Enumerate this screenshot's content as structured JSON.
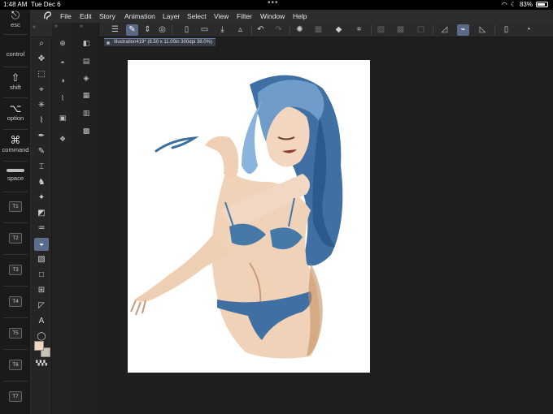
{
  "status_bar": {
    "time": "1:48 AM",
    "date": "Tue Dec 6",
    "battery": "83%",
    "battery_level": 0.83
  },
  "modifier_panel": {
    "keys": [
      {
        "glyph": "⎋",
        "label": "esc"
      },
      {
        "glyph": "",
        "label": "control"
      },
      {
        "glyph": "⇧",
        "label": "shift"
      },
      {
        "glyph": "⌥",
        "label": "option"
      },
      {
        "glyph": "⌘",
        "label": "command"
      },
      {
        "glyph": "",
        "label": "space"
      }
    ],
    "tool_keys": [
      "T1",
      "T2",
      "T3",
      "T4",
      "T5",
      "T6",
      "T7"
    ]
  },
  "menu": {
    "items": [
      "File",
      "Edit",
      "Story",
      "Animation",
      "Layer",
      "Select",
      "View",
      "Filter",
      "Window",
      "Help"
    ]
  },
  "document": {
    "tab_title": "Illustration419* (8.50 x 11.00in 300dpi 38.0%)"
  },
  "tools": {
    "icons": [
      "zoom-icon",
      "move-icon",
      "operation-icon",
      "selection-icon",
      "auto-select-icon",
      "eyedropper-icon",
      "pen-icon",
      "pencil-icon",
      "brush-icon",
      "airbrush-icon",
      "decoration-icon",
      "eraser-icon",
      "blend-icon",
      "fill-icon",
      "gradient-icon",
      "figure-icon",
      "frame-icon",
      "ruler-icon",
      "text-icon",
      "balloon-icon"
    ],
    "active_tool": "fill-icon"
  },
  "colors": {
    "main_color": "#f2d6be",
    "sub_color": "#c9c3b4",
    "accent": "#5b6d8e",
    "canvas_bg": "#1e1e1e",
    "paper": "#ffffff"
  }
}
